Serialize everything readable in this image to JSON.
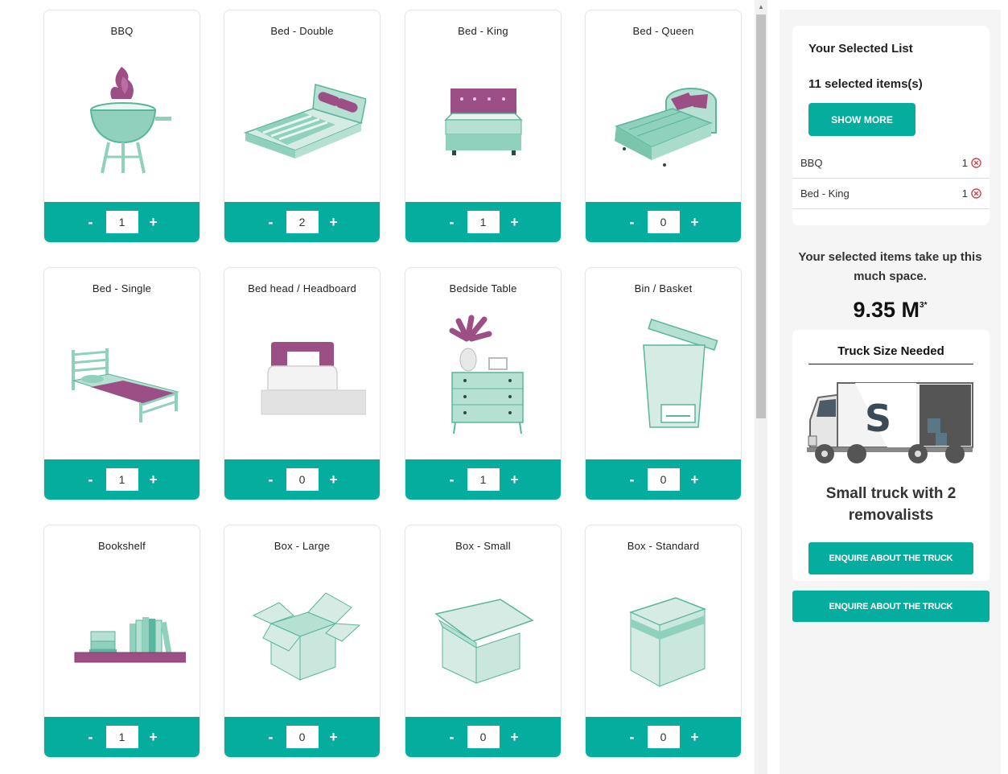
{
  "items": [
    {
      "name": "BBQ",
      "qty": "1",
      "icon": "bbq-icon"
    },
    {
      "name": "Bed - Double",
      "qty": "2",
      "icon": "double-bed-icon"
    },
    {
      "name": "Bed - King",
      "qty": "1",
      "icon": "king-bed-icon"
    },
    {
      "name": "Bed - Queen",
      "qty": "0",
      "icon": "queen-bed-icon"
    },
    {
      "name": "Bed - Single",
      "qty": "1",
      "icon": "single-bed-icon"
    },
    {
      "name": "Bed head / Headboard",
      "qty": "0",
      "icon": "headboard-icon"
    },
    {
      "name": "Bedside Table",
      "qty": "1",
      "icon": "bedside-table-icon"
    },
    {
      "name": "Bin / Basket",
      "qty": "0",
      "icon": "bin-icon"
    },
    {
      "name": "Bookshelf",
      "qty": "1",
      "icon": "bookshelf-icon"
    },
    {
      "name": "Box - Large",
      "qty": "0",
      "icon": "large-box-icon"
    },
    {
      "name": "Box - Small",
      "qty": "0",
      "icon": "small-box-icon"
    },
    {
      "name": "Box - Standard",
      "qty": "0",
      "icon": "standard-box-icon"
    }
  ],
  "controls": {
    "minus": "-",
    "plus": "+"
  },
  "selected_list": {
    "title": "Your Selected List",
    "count_text": "11 selected items(s)",
    "show_more_label": "SHOW MORE",
    "rows": [
      {
        "name": "BBQ",
        "qty": "1"
      },
      {
        "name": "Bed - King",
        "qty": "1"
      }
    ]
  },
  "space": {
    "text": "Your selected items take up this much space.",
    "value": "9.35 M",
    "unit_suffix": "3*"
  },
  "truck": {
    "title": "Truck Size Needed",
    "logo_letter": "S",
    "name": "Small truck with 2 removalists",
    "enquire_label": "ENQUIRE ABOUT THE TRUCK"
  },
  "enquire_bottom_label": "ENQUIRE ABOUT THE TRUCK",
  "colors": {
    "teal": "#05ad9f",
    "plum": "#9b4f85",
    "mint": "#8fd1bc",
    "remove": "#d9363e"
  }
}
